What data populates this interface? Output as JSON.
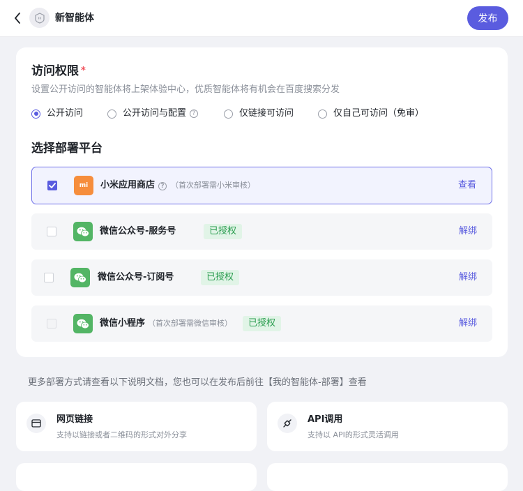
{
  "header": {
    "title": "新智能体",
    "publish_label": "发布"
  },
  "access": {
    "title": "访问权限",
    "required_mark": "*",
    "description": "设置公开访问的智能体将上架体验中心，优质智能体将有机会在百度搜索分发",
    "options": [
      {
        "label": "公开访问",
        "selected": true
      },
      {
        "label": "公开访问与配置",
        "selected": false,
        "has_help": true
      },
      {
        "label": "仅链接可访问",
        "selected": false
      },
      {
        "label": "仅自己可访问（免审）",
        "selected": false
      }
    ]
  },
  "deploy": {
    "title": "选择部署平台",
    "platforms": [
      {
        "name": "小米应用商店",
        "icon": "mi-logo-icon",
        "icon_text": "mi",
        "note": "（首次部署需小米审核）",
        "action": "查看",
        "checked": true
      },
      {
        "name": "微信公众号-服务号",
        "icon": "wechat-icon",
        "badge": "已授权",
        "action": "解绑",
        "checked": false
      },
      {
        "name": "微信公众号-订阅号",
        "icon": "wechat-icon",
        "badge": "已授权",
        "action": "解绑",
        "checked": false
      },
      {
        "name": "微信小程序",
        "icon": "wechat-icon",
        "note": "（首次部署需微信审核）",
        "badge": "已授权",
        "action": "解绑",
        "checked": false,
        "disabled": true
      }
    ]
  },
  "more_tip": "更多部署方式请查看以下说明文档，您也可以在发布后前往【我的智能体-部署】查看",
  "methods": [
    {
      "title": "网页链接",
      "desc": "支持以链接或者二维码的形式对外分享",
      "icon": "web-card-icon"
    },
    {
      "title": "API调用",
      "desc": "支持以 API的形式灵活调用",
      "icon": "api-plug-icon"
    }
  ],
  "colors": {
    "accent": "#5a5cdf",
    "authorized_green": "#2a9d4f",
    "xiaomi_orange": "#f68d3c",
    "wechat_green": "#53b565"
  }
}
